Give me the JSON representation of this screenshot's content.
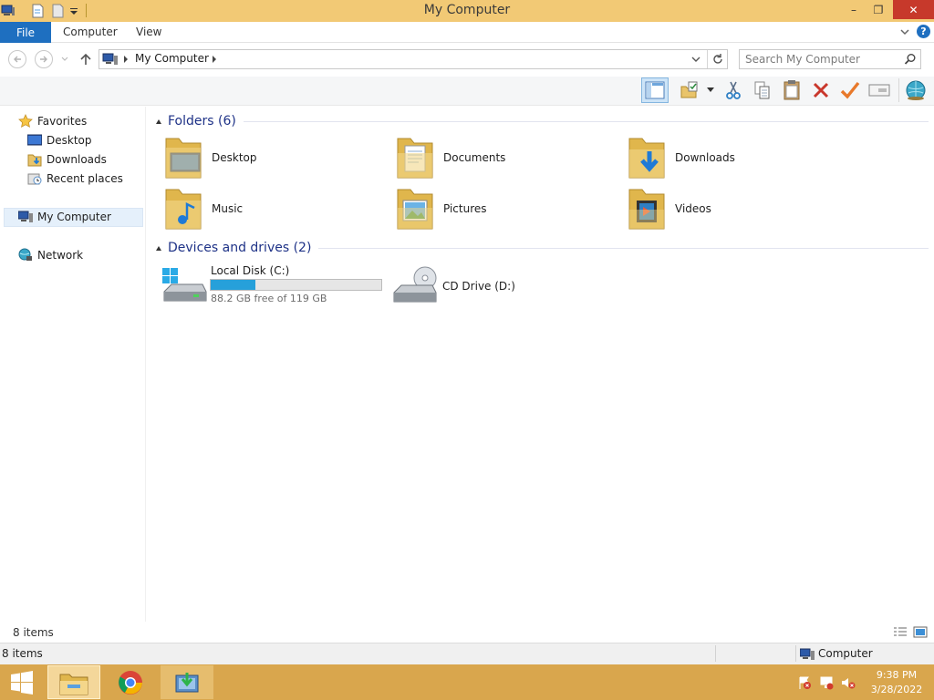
{
  "window": {
    "title": "My Computer",
    "controls": {
      "minimize": "–",
      "restore": "❐",
      "close": "✕"
    }
  },
  "ribbon": {
    "tabs": {
      "file": "File",
      "computer": "Computer",
      "view": "View"
    }
  },
  "address": {
    "path": "My Computer",
    "search_placeholder": "Search My Computer"
  },
  "toolbar": {
    "items": [
      "preview-pane-icon",
      "properties-icon",
      "cut-icon",
      "copy-icon",
      "paste-icon",
      "delete-icon",
      "checkmark-icon",
      "rename-icon",
      "network-globe-icon"
    ]
  },
  "nav": {
    "favorites": "Favorites",
    "desktop": "Desktop",
    "downloads": "Downloads",
    "recent": "Recent places",
    "my_computer": "My Computer",
    "network": "Network"
  },
  "content": {
    "folders_header": "Folders (6)",
    "folders": [
      "Desktop",
      "Documents",
      "Downloads",
      "Music",
      "Pictures",
      "Videos"
    ],
    "drives_header": "Devices and drives (2)",
    "drive_c": {
      "name": "Local Disk (C:)",
      "free_text": "88.2 GB free of 119 GB",
      "used_fraction": 0.26
    },
    "drive_d": {
      "name": "CD Drive (D:)"
    }
  },
  "status": {
    "items": "8 items",
    "items_bottom": "8 items",
    "location": "Computer"
  },
  "taskbar": {
    "time": "9:38 PM",
    "date": "3/28/2022"
  },
  "colors": {
    "titlebar": "#f2c975",
    "file_tab": "#1e6fc0",
    "close_button": "#c7392b",
    "progress": "#26a0da",
    "taskbar": "#d9a64d"
  }
}
